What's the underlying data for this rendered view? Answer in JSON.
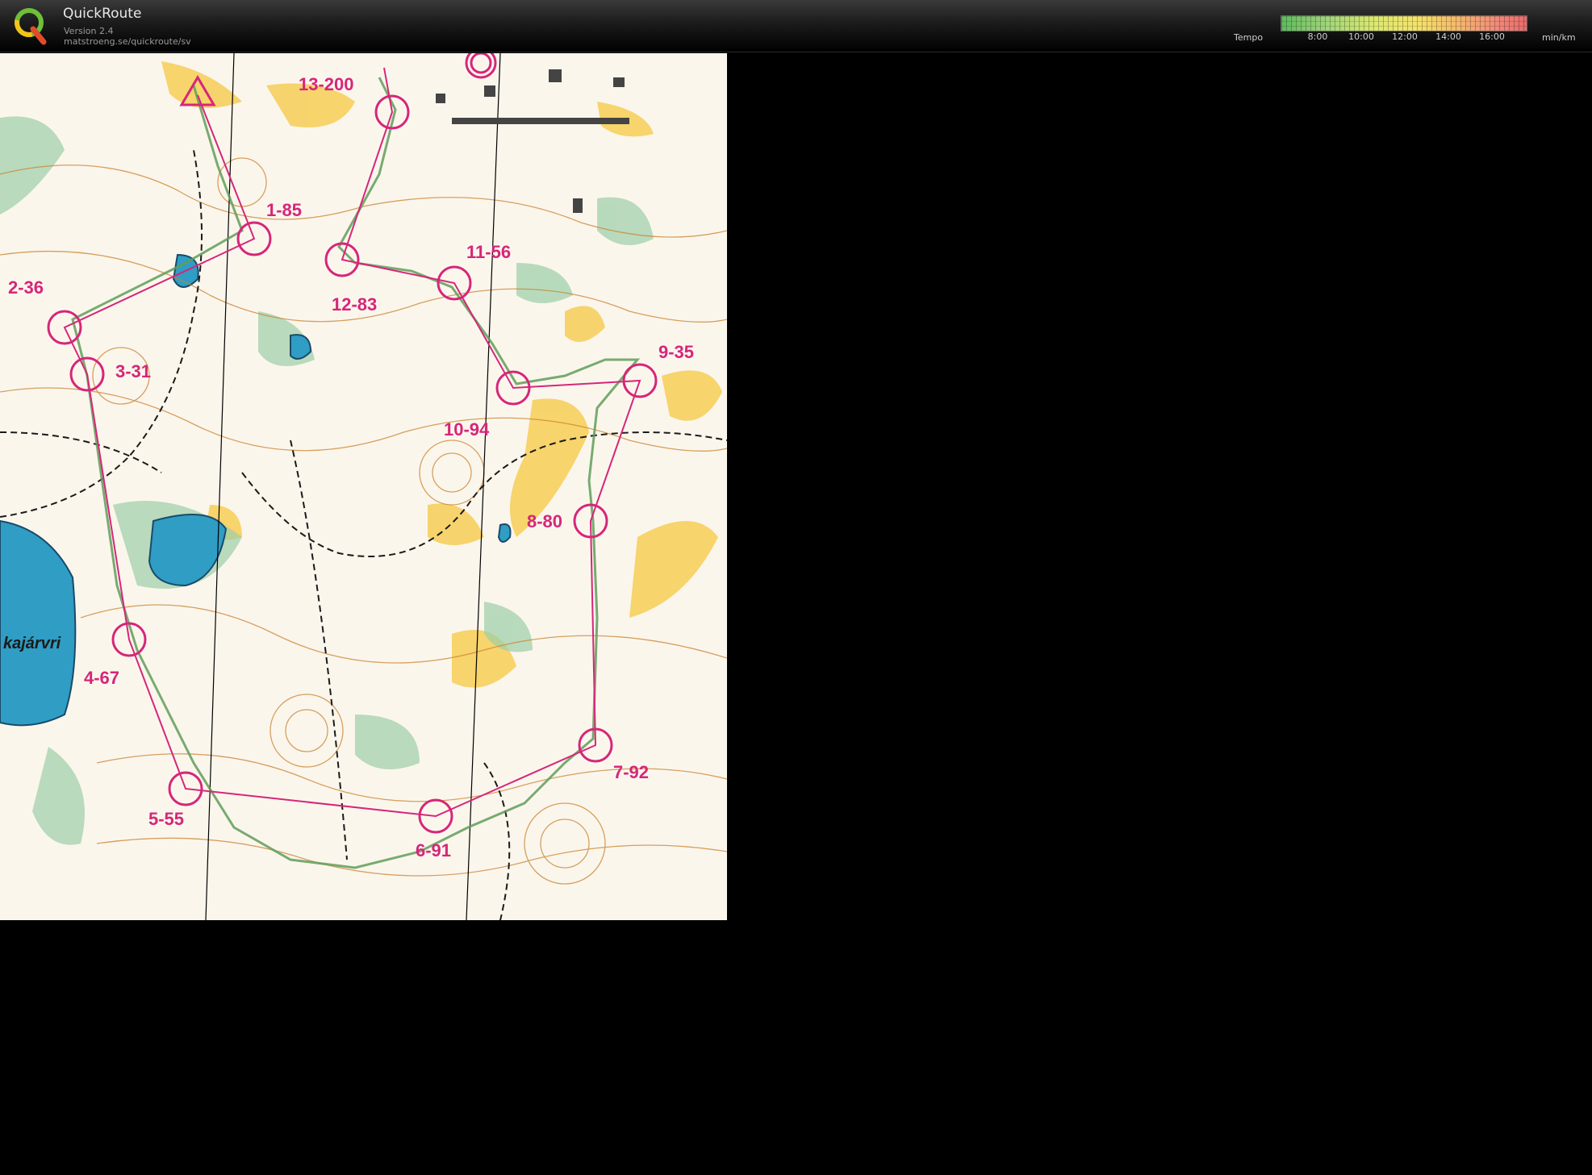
{
  "app": {
    "title": "QuickRoute",
    "version": "Version 2.4",
    "url": "matstroeng.se/quickroute/sv"
  },
  "legend": {
    "label": "Tempo",
    "ticks": [
      "8:00",
      "10:00",
      "12:00",
      "14:00",
      "16:00"
    ],
    "unit": "min/km"
  },
  "map": {
    "lake_label": "kajárvri",
    "controls": [
      {
        "label": "1-85"
      },
      {
        "label": "2-36"
      },
      {
        "label": "3-31"
      },
      {
        "label": "4-67"
      },
      {
        "label": "5-55"
      },
      {
        "label": "6-91"
      },
      {
        "label": "7-92"
      },
      {
        "label": "8-80"
      },
      {
        "label": "9-35"
      },
      {
        "label": "10-94"
      },
      {
        "label": "11-56"
      },
      {
        "label": "12-83"
      },
      {
        "label": "13-200"
      }
    ]
  },
  "colors": {
    "course": "#d6267a",
    "route": "#5f9e5a",
    "map_bg": "#fbf6ec"
  }
}
